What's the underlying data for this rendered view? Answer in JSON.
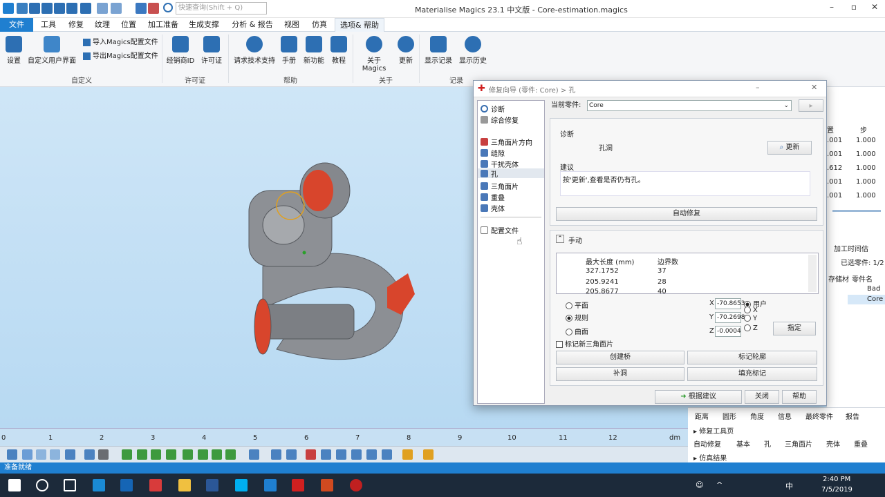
{
  "app": {
    "title": "Materialise Magics 23.1 中文版 - Core-estimation.magics",
    "search_placeholder": "快速查询(Shift + Q)"
  },
  "tabs": [
    "文件",
    "工具",
    "修复",
    "纹理",
    "位置",
    "加工准备",
    "生成支撑",
    "分析 & 报告",
    "视图",
    "仿真",
    "选项& 帮助"
  ],
  "ribbon": {
    "customize": {
      "settings": "设置",
      "custom_ui": "自定义用户界面",
      "import_cfg": "导入Magics配置文件",
      "export_cfg": "导出Magics配置文件",
      "group": "自定义"
    },
    "license": {
      "dealer": "经销商ID",
      "license": "许可证",
      "group": "许可证"
    },
    "help": {
      "support": "请求技术支持",
      "manual": "手册",
      "new": "新功能",
      "tutorial": "教程",
      "group": "帮助"
    },
    "about": {
      "about": "关于Magics",
      "update": "更新",
      "group": "关于"
    },
    "log": {
      "show_log": "显示记录",
      "show_history": "显示历史",
      "group": "记录"
    }
  },
  "dialog": {
    "title": "修复向导 (零件: Core) > 孔",
    "nav": [
      "诊断",
      "综合修复",
      "三角面片方向",
      "缝隙",
      "干扰壳体",
      "孔",
      "三角面片",
      "重叠",
      "壳体",
      "配置文件"
    ],
    "current_part_label": "当前零件:",
    "current_part": "Core",
    "diag_label": "诊断",
    "diag_item": "孔洞",
    "update_btn": "更新",
    "suggest_label": "建议",
    "suggest_text": "按'更新',查看是否仍有孔。",
    "auto_fix": "自动修复",
    "manual_label": "手动",
    "table_headers": [
      "最大长度 (mm)",
      "边界数"
    ],
    "table_rows": [
      [
        "327.1752",
        "37"
      ],
      [
        "205.9241",
        "28"
      ],
      [
        "205.8677",
        "40"
      ]
    ],
    "modes": [
      "平面",
      "规则",
      "曲面"
    ],
    "coords": {
      "x": "-70.8653",
      "y": "-70.2698",
      "z": "-0.0004"
    },
    "coord_labels": [
      "X",
      "Y",
      "Z"
    ],
    "axis_opts": [
      "用户",
      "X",
      "Y",
      "Z"
    ],
    "assign": "指定",
    "mark_new": "标记新三角面片",
    "create_bridge": "创建桥",
    "mark_contour": "标记轮廓",
    "fill_hole": "补洞",
    "fill_mark": "填充标记",
    "follow": "根据建议",
    "close": "关闭",
    "help": "帮助"
  },
  "right_panel": {
    "headers": [
      "置",
      "步"
    ],
    "rows": [
      [
        ".001",
        "1.000"
      ],
      [
        ".001",
        "1.000"
      ],
      [
        ".612",
        "1.000"
      ],
      [
        ".001",
        "1.000"
      ],
      [
        ".001",
        "1.000"
      ]
    ],
    "time_label": "加工时间估",
    "selected": "已选零件: 1/2",
    "part_hdr": [
      "存储材",
      "零件名"
    ],
    "parts": [
      "Bad",
      "Core"
    ],
    "bottom_tabs": [
      "距离",
      "圆形",
      "角度",
      "信息",
      "最终零件",
      "报告"
    ],
    "toolpage": "修复工具页",
    "tool_tabs": [
      "自动修复",
      "基本",
      "孔",
      "三角面片",
      "壳体",
      "重叠"
    ],
    "sim": "仿真结果"
  },
  "ruler": {
    "ticks": [
      "0",
      "1",
      "2",
      "3",
      "4",
      "5",
      "6",
      "7",
      "8",
      "9",
      "10",
      "11",
      "12"
    ],
    "unit": "dm"
  },
  "status": "准备就绪",
  "taskbar": {
    "time": "2:40 PM",
    "date": "7/5/2019",
    "ime": "中"
  }
}
